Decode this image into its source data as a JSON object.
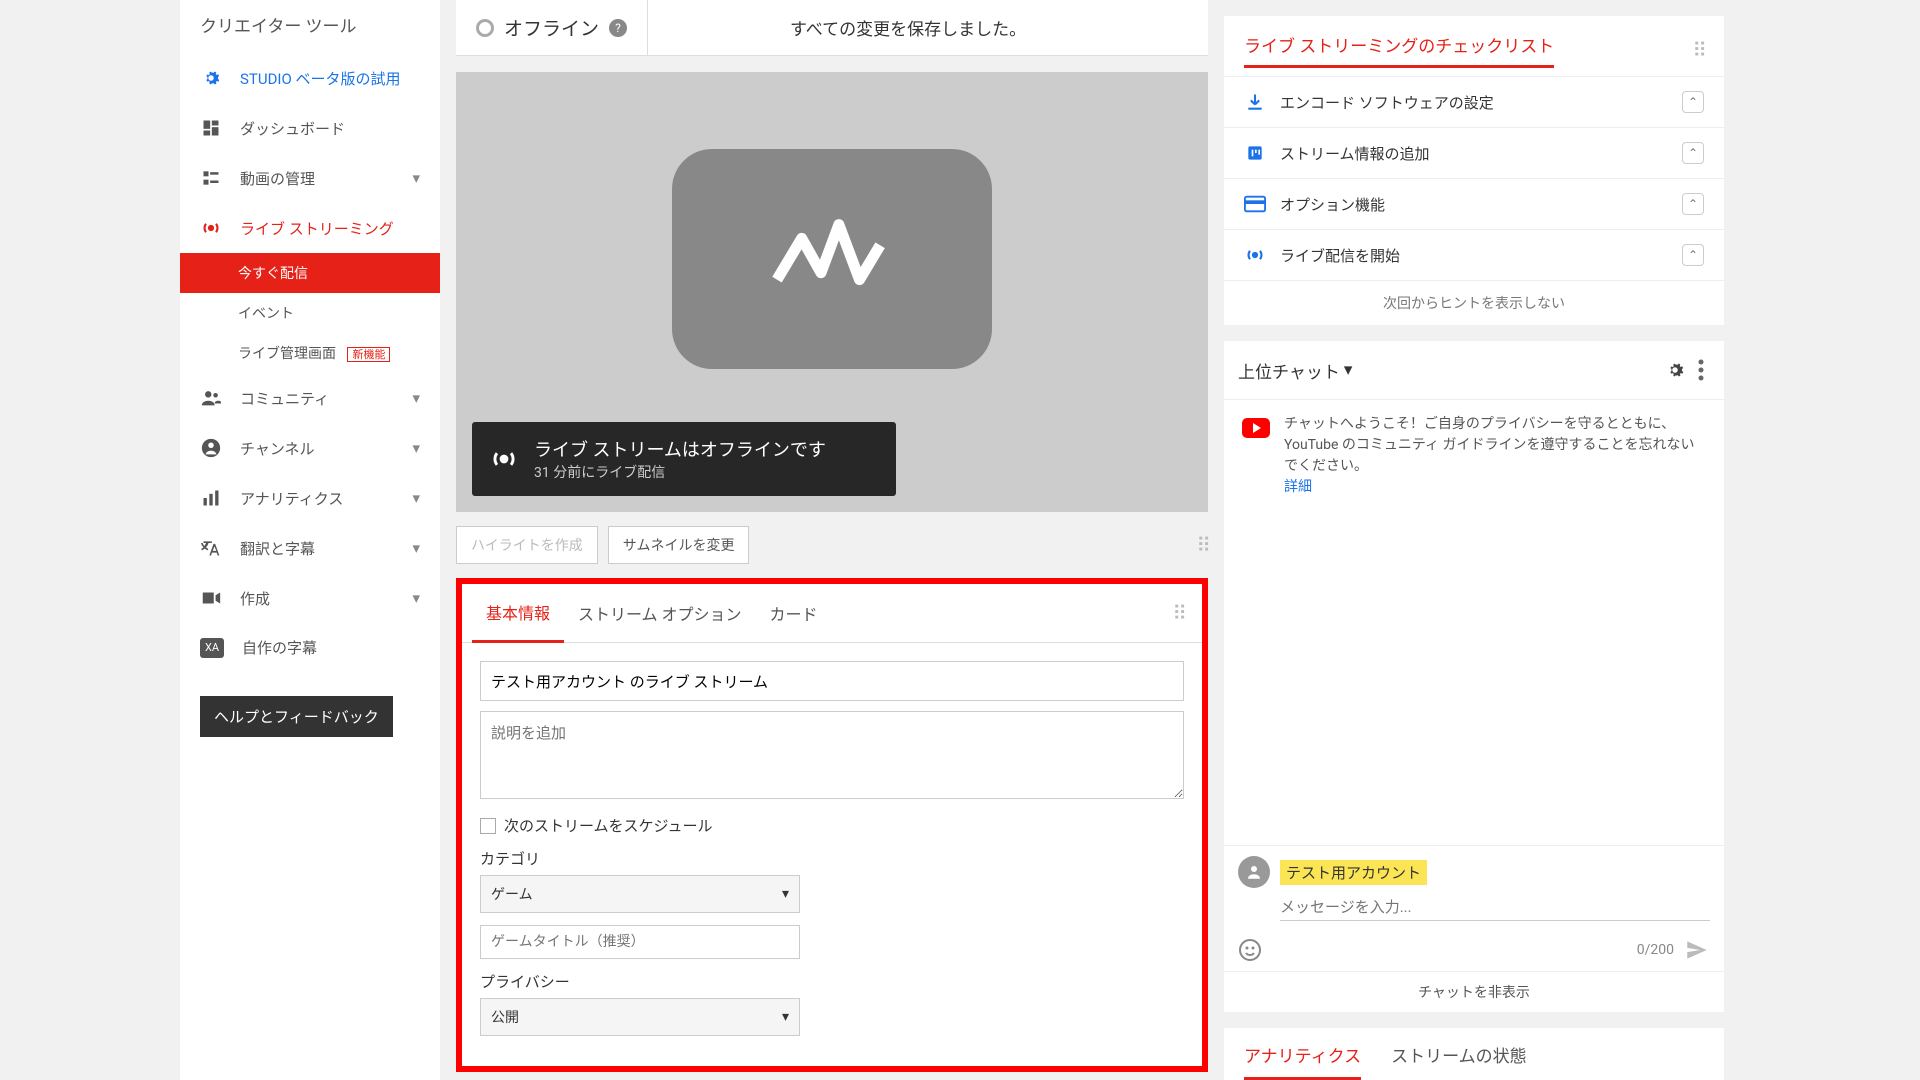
{
  "sidebar": {
    "title": "クリエイター ツール",
    "studio": "STUDIO ベータ版の試用",
    "dashboard": "ダッシュボード",
    "videoManager": "動画の管理",
    "live": "ライブ ストリーミング",
    "subStreamNow": "今すぐ配信",
    "subEvent": "イベント",
    "subLiveControl": "ライブ管理画面",
    "newBadge": "新機能",
    "community": "コミュニティ",
    "channel": "チャンネル",
    "analytics": "アナリティクス",
    "translate": "翻訳と字幕",
    "create": "作成",
    "ownCaptions": "自作の字幕",
    "help": "ヘルプとフィードバック"
  },
  "topbar": {
    "status": "オフライン",
    "saved": "すべての変更を保存しました。"
  },
  "overlay": {
    "title": "ライブ ストリームはオフラインです",
    "sub": "31 分前にライブ配信"
  },
  "below": {
    "highlight": "ハイライトを作成",
    "thumbnail": "サムネイルを変更"
  },
  "tabs": {
    "basic": "基本情報",
    "streamOptions": "ストリーム オプション",
    "card": "カード"
  },
  "form": {
    "titleValue": "テスト用アカウント のライブ ストリーム",
    "descPlaceholder": "説明を追加",
    "scheduleLabel": "次のストリームをスケジュール",
    "categoryLabel": "カテゴリ",
    "categoryValue": "ゲーム",
    "gameTitlePlaceholder": "ゲームタイトル（推奨）",
    "privacyLabel": "プライバシー",
    "privacyValue": "公開"
  },
  "checklist": {
    "title": "ライブ ストリーミングのチェックリスト",
    "items": [
      "エンコード ソフトウェアの設定",
      "ストリーム情報の追加",
      "オプション機能",
      "ライブ配信を開始"
    ],
    "hideHint": "次回からヒントを表示しない"
  },
  "chat": {
    "title": "上位チャット",
    "welcome": "チャットへようこそ！ご自身のプライバシーを守るとともに、YouTube のコミュニティ ガイドラインを遵守することを忘れないでください。",
    "detailsLink": "詳細",
    "username": "テスト用アカウント",
    "placeholder": "メッセージを入力...",
    "count": "0/200",
    "hide": "チャットを非表示"
  },
  "analytics": {
    "tab1": "アナリティクス",
    "tab2": "ストリームの状態"
  }
}
